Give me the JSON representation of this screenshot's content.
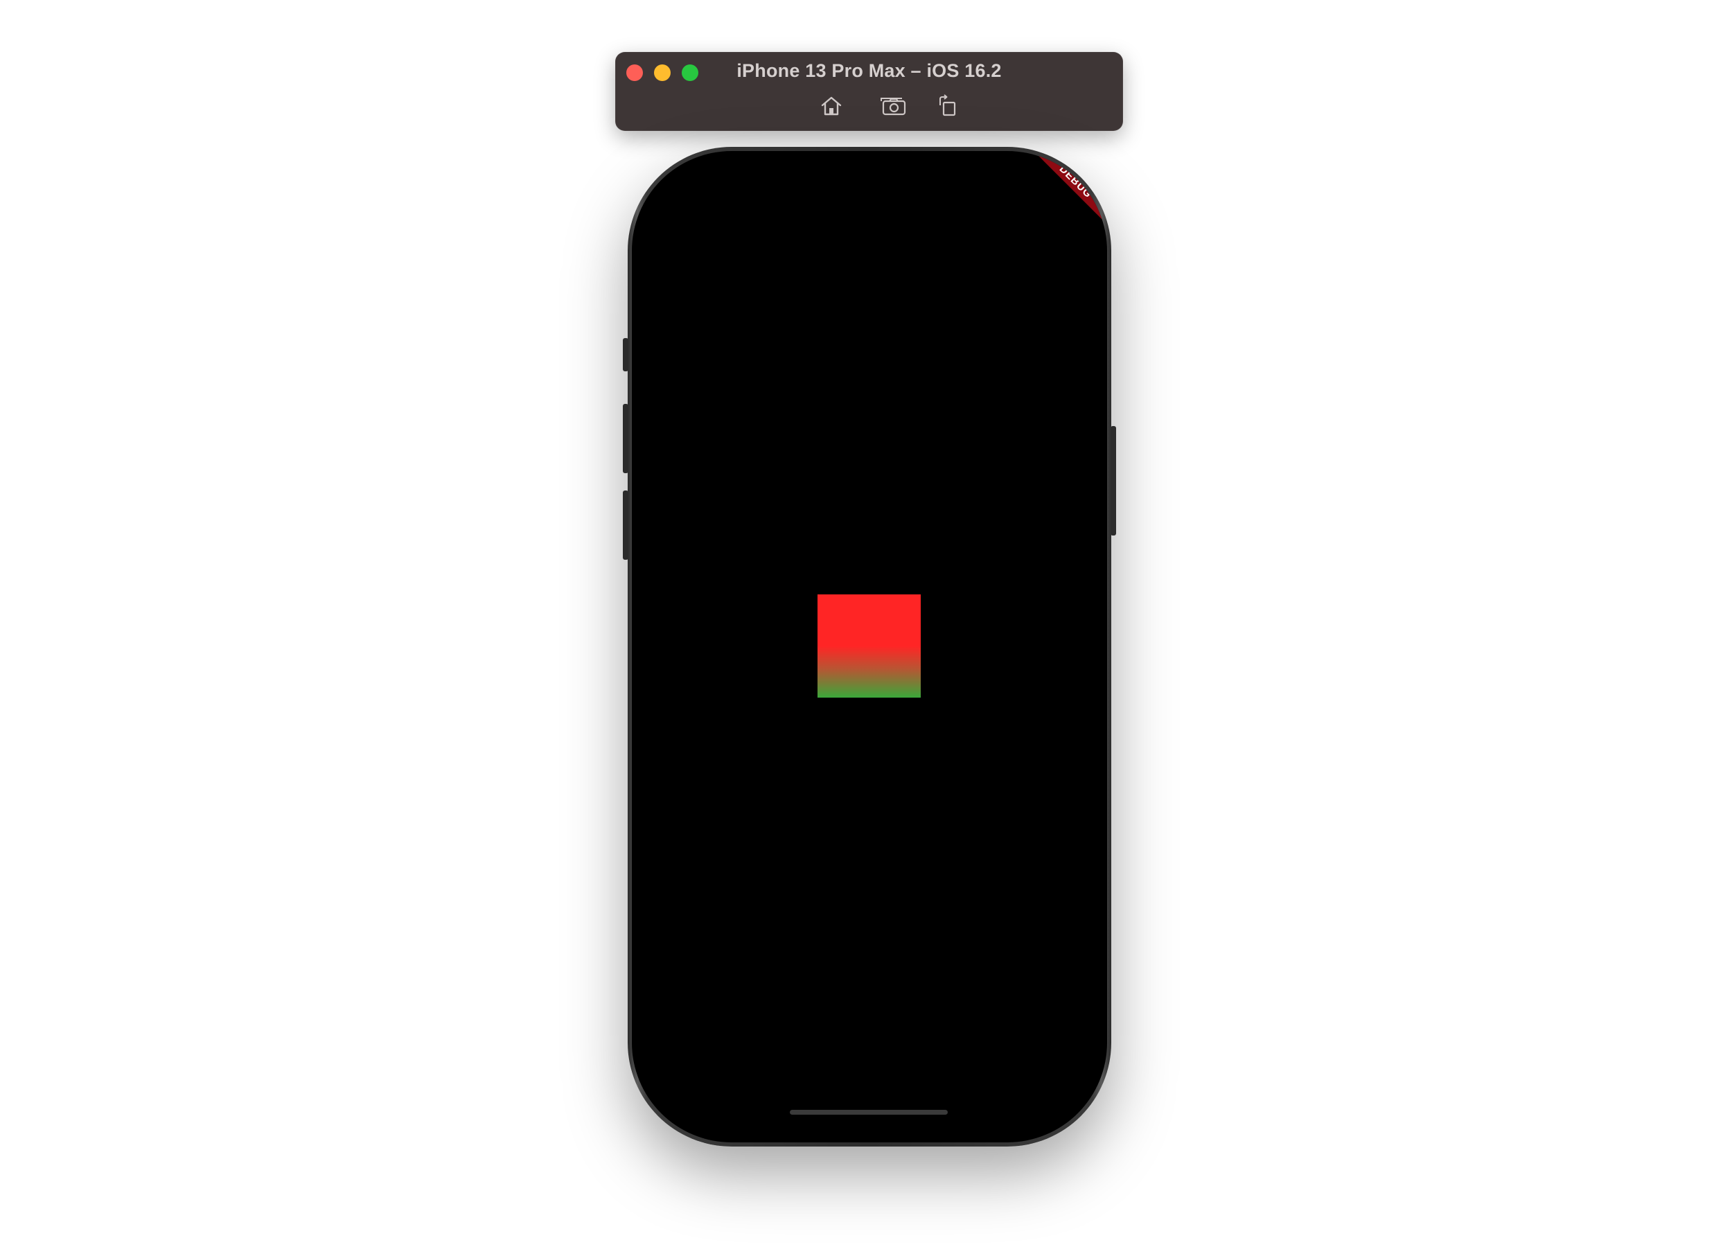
{
  "window": {
    "title": "iPhone 13 Pro Max – iOS 16.2",
    "toolbar": {
      "home_icon": "home-icon",
      "screenshot_icon": "camera-icon",
      "rotate_icon": "rotate-icon"
    },
    "traffic_lights": {
      "close_color": "#fe5f57",
      "minimize_color": "#febc2e",
      "zoom_color": "#28c840"
    }
  },
  "screen": {
    "background_color": "#000000",
    "debug_banner": "DEBUG",
    "gradient_box": {
      "top_color": "#ff2525",
      "bottom_color": "#3aa83a"
    }
  }
}
